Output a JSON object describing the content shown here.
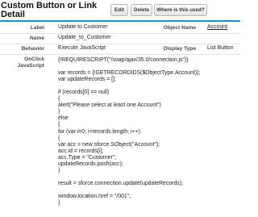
{
  "header": {
    "title": "Custom Button or Link Detail",
    "buttons": [
      "Edit",
      "Delete",
      "Where is this used?"
    ]
  },
  "detail": {
    "rows": [
      {
        "label": "Label",
        "value": "Update to Customer",
        "label2": "Object Name",
        "value2": "Account"
      },
      {
        "label": "Name",
        "value": "Update_to_Customer"
      },
      {
        "label": "Behavior",
        "value": "Execute JavaScript",
        "label2": "Display Type",
        "value2": "List Button"
      }
    ],
    "onclick_label": "OnClick JavaScript",
    "code_lines": [
      "{!REQUIRESCRIPT(\"/soap/ajax/35.0/connection.js\")}",
      "",
      "var records = {!GETRECORDIDS($ObjectType.Account)};",
      "var updateRecords = [];",
      "",
      "if (records[0] == null)",
      "{",
      "alert(\"Please select at least one Account\")",
      "}",
      "else",
      "{",
      "for (var i=0; i<records.length; i++)",
      "{",
      "var acc = new sforce.SObject(\"Account\");",
      "acc.id = records[i];",
      "acc.Type = \"Customer\";",
      "updateRecords.push(acc);",
      "}",
      "",
      "result = sforce.connection.update(updateRecords);",
      "",
      "window.location.href = \"/001\";",
      "}"
    ]
  }
}
